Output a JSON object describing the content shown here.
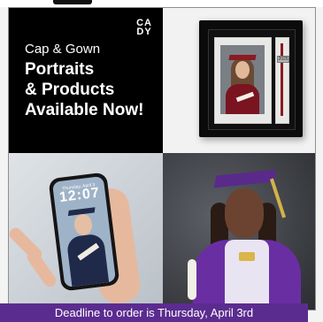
{
  "brand": {
    "logo_line1": "CA",
    "logo_line2": "DY"
  },
  "hero": {
    "eyebrow": "Cap & Gown",
    "headline_lines": [
      "Portraits",
      "& Products",
      "Available Now!"
    ]
  },
  "phone": {
    "time": "12:07",
    "date": "Thursday, April 3"
  },
  "shadowbox": {
    "charm_text": "2025"
  },
  "footer": {
    "text": "Deadline to order is Thursday, April 3rd"
  },
  "colors": {
    "footer_bg": "#5b2c8f",
    "panel_black": "#000000",
    "gown_purple": "#6a2ea3"
  }
}
